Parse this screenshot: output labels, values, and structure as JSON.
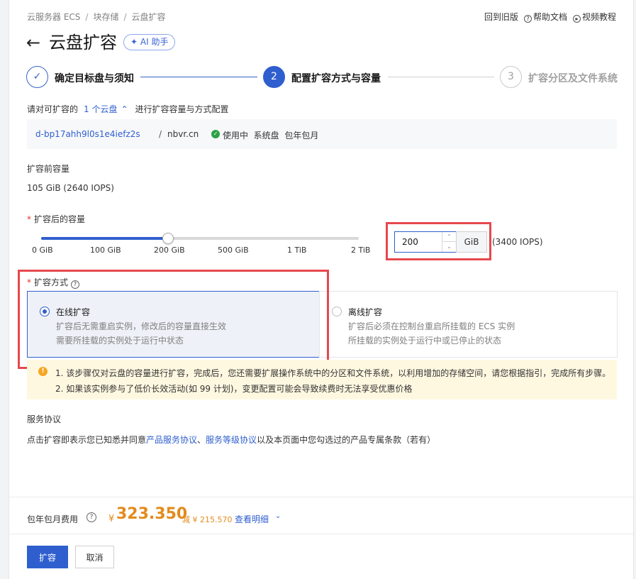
{
  "breadcrumb": [
    "云服务器 ECS",
    "块存储",
    "云盘扩容"
  ],
  "top_links": {
    "old_version": "回到旧版",
    "help_docs": "帮助文档",
    "video_tutorial": "视频教程"
  },
  "title": "云盘扩容",
  "ai_assistant": "AI 助手",
  "steps": [
    {
      "number": "✓",
      "label": "确定目标盘与须知",
      "state": "done"
    },
    {
      "number": "2",
      "label": "配置扩容方式与容量",
      "state": "active"
    },
    {
      "number": "3",
      "label": "扩容分区及文件系统",
      "state": "pending"
    }
  ],
  "disk_selection": {
    "prefix": "请对可扩容的",
    "count_link": "1 个云盘",
    "suffix": "进行扩容容量与方式配置"
  },
  "disk": {
    "id": "d-bp17ahh9l0s1e4iefz2s",
    "separator": "/",
    "host": "nbvr.cn",
    "status": "使用中",
    "type": "系统盘",
    "billing": "包年包月"
  },
  "capacity_before": {
    "label": "扩容前容量",
    "value": "105 GiB  (2640 IOPS)"
  },
  "capacity_after": {
    "label": "扩容后的容量",
    "slider_ticks": [
      "0 GiB",
      "100 GiB",
      "200 GiB",
      "500 GiB",
      "1 TiB",
      "2 TiB"
    ],
    "slider_value_fraction": 0.4,
    "input_value": "200",
    "unit": "GiB",
    "iops": "(3400 IOPS)"
  },
  "method": {
    "label": "扩容方式",
    "options": [
      {
        "title": "在线扩容",
        "desc1": "扩容后无需重启实例，修改后的容量直接生效",
        "desc2": "需要所挂载的实例处于运行中状态",
        "selected": true
      },
      {
        "title": "离线扩容",
        "desc1": "扩容后必须在控制台重启所挂载的 ECS 实例",
        "desc2": "所挂载的实例处于运行中或已停止的状态",
        "selected": false
      }
    ]
  },
  "notice": {
    "line1": "1. 该步骤仅对云盘的容量进行扩容，完成后，您还需要扩展操作系统中的分区和文件系统，以利用增加的存储空间，请您根据指引，完成所有步骤。",
    "line2": "2. 如果该实例参与了低价长效活动(如 99 计划)，变更配置可能会导致续费时无法享受优惠价格"
  },
  "service": {
    "title": "服务协议",
    "text_prefix": "点击扩容即表示您已知悉并同意",
    "link1": "产品服务协议",
    "sep": "、",
    "link2": "服务等级协议",
    "text_suffix": "以及本页面中您勾选过的产品专属条款（若有）"
  },
  "fee": {
    "label": "包年包月费用",
    "currency": "¥",
    "price": "323.350",
    "discount": "减 ¥ 215.570",
    "detail": "查看明细"
  },
  "buttons": {
    "expand": "扩容",
    "cancel": "取消"
  },
  "colors": {
    "primary": "#2f5fcf",
    "price": "#e38b1c",
    "highlight": "#e6484d",
    "success": "#2ba245"
  }
}
